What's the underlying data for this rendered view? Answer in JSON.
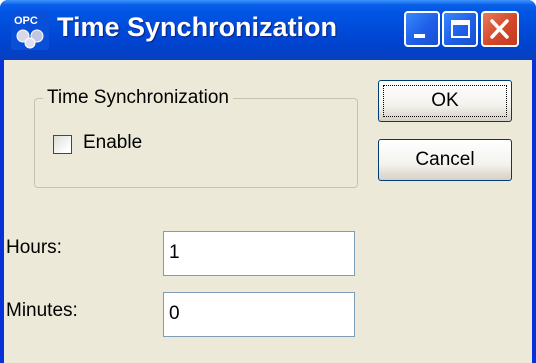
{
  "window": {
    "title": "Time Synchronization",
    "app_icon": "opc-icon",
    "controls": [
      "minimize-icon",
      "maximize-icon",
      "close-icon"
    ]
  },
  "groupbox": {
    "legend": "Time Synchronization",
    "checkbox_label": "Enable",
    "checkbox_checked": false
  },
  "buttons": {
    "ok_label": "OK",
    "cancel_label": "Cancel"
  },
  "fields": {
    "hours_label": "Hours:",
    "hours_value": "1",
    "minutes_label": "Minutes:",
    "minutes_value": "0"
  },
  "colors": {
    "titlebar": "#0055e5",
    "dialog_bg": "#ece9d8",
    "close_button": "#d4482a"
  }
}
